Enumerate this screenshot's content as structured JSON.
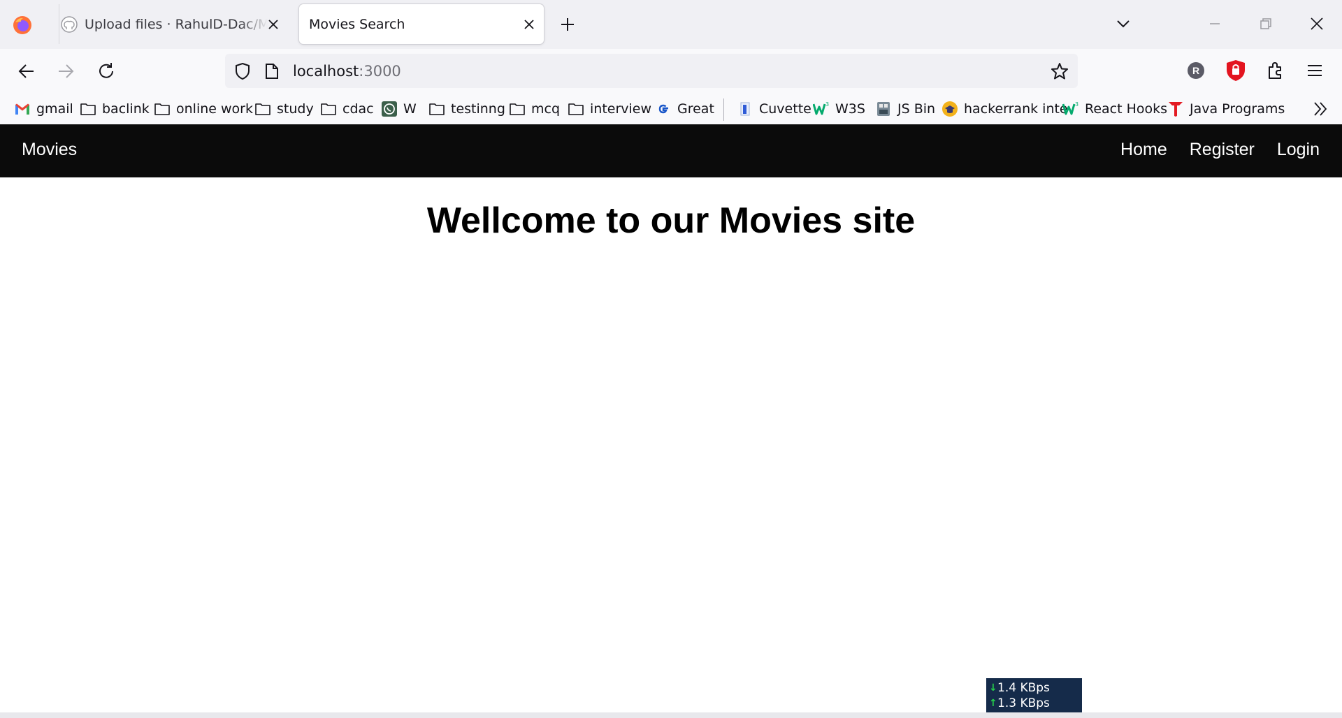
{
  "browser": {
    "tabs": [
      {
        "title": "Upload files · RahulD-Dac/Mern-apps",
        "active": false
      },
      {
        "title": "Movies Search",
        "active": true
      }
    ],
    "url": {
      "host": "localhost",
      "port": ":3000"
    },
    "profile_initial": "R"
  },
  "bookmarks": [
    {
      "label": "gmail",
      "icon": "gmail-icon"
    },
    {
      "label": "baclink",
      "icon": "folder-icon"
    },
    {
      "label": "online work",
      "icon": "folder-icon"
    },
    {
      "label": "study",
      "icon": "folder-icon"
    },
    {
      "label": "cdac",
      "icon": "folder-icon"
    },
    {
      "label": "W",
      "icon": "whatsapp-icon"
    },
    {
      "label": "testinng",
      "icon": "folder-icon"
    },
    {
      "label": "mcq",
      "icon": "folder-icon"
    },
    {
      "label": "interview",
      "icon": "folder-icon"
    },
    {
      "label": "Great",
      "icon": "google-icon"
    },
    {
      "label": "Cuvette",
      "icon": "cuvette-icon"
    },
    {
      "label": "W3S",
      "icon": "w3schools-icon"
    },
    {
      "label": "JS Bin",
      "icon": "jsbin-icon"
    },
    {
      "label": "hackerrank inte",
      "icon": "hackerrank-icon"
    },
    {
      "label": "React Hooks",
      "icon": "w3schools-icon"
    },
    {
      "label": "Java Programs",
      "icon": "java-t-icon"
    }
  ],
  "site": {
    "brand": "Movies",
    "nav": {
      "home": "Home",
      "register": "Register",
      "login": "Login"
    },
    "heading": "Wellcome to our Movies site"
  },
  "speed_widget": {
    "download": "1.4 KBps",
    "upload": "1.3 KBps"
  },
  "colors": {
    "site_nav_bg": "#0b0b0b",
    "tabstrip_bg": "#f0f0f4",
    "toolbar_bg": "#f9f9fb",
    "speed_bg": "#152b4a",
    "speed_arrow": "#25d04a"
  }
}
